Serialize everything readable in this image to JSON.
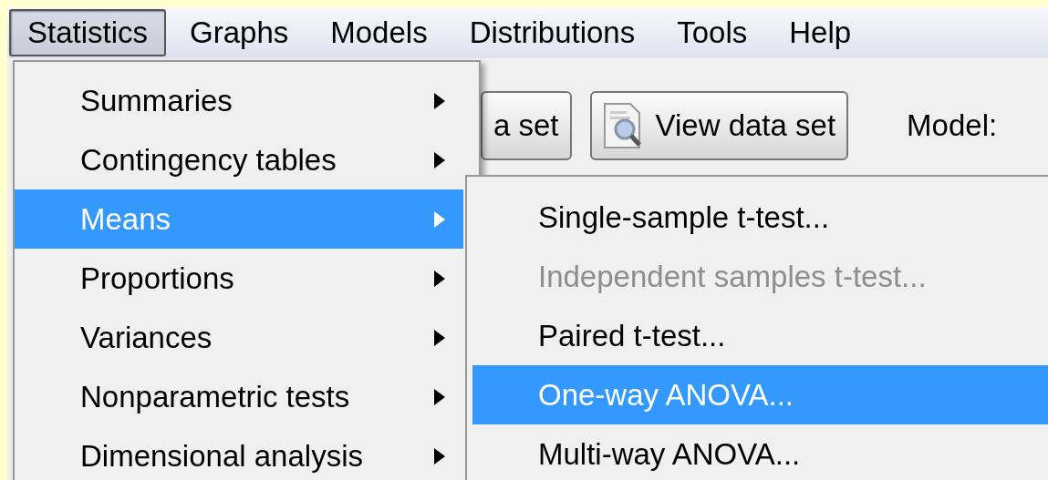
{
  "menu_bar": [
    {
      "label": "Statistics",
      "selected": true
    },
    {
      "label": "Graphs",
      "selected": false
    },
    {
      "label": "Models",
      "selected": false
    },
    {
      "label": "Distributions",
      "selected": false
    },
    {
      "label": "Tools",
      "selected": false
    },
    {
      "label": "Help",
      "selected": false
    }
  ],
  "toolbar": {
    "buttons": [
      {
        "label": "a set",
        "kind": "text"
      },
      {
        "label": "View data set",
        "kind": "icon"
      }
    ],
    "model_label": "Model:"
  },
  "menu": {
    "items": [
      {
        "label": "Summaries",
        "selected": false
      },
      {
        "label": "Contingency tables",
        "selected": false
      },
      {
        "label": "Means",
        "selected": true
      },
      {
        "label": "Proportions",
        "selected": false
      },
      {
        "label": "Variances",
        "selected": false
      },
      {
        "label": "Nonparametric tests",
        "selected": false
      },
      {
        "label": "Dimensional analysis",
        "selected": false
      }
    ]
  },
  "submenu": {
    "items": [
      {
        "label": "Single-sample t-test...",
        "selected": false,
        "disabled": false
      },
      {
        "label": "Independent samples t-test...",
        "selected": false,
        "disabled": true
      },
      {
        "label": "Paired t-test...",
        "selected": false,
        "disabled": false
      },
      {
        "label": "One-way ANOVA...",
        "selected": true,
        "disabled": false
      },
      {
        "label": "Multi-way ANOVA...",
        "selected": false,
        "disabled": false
      }
    ]
  }
}
